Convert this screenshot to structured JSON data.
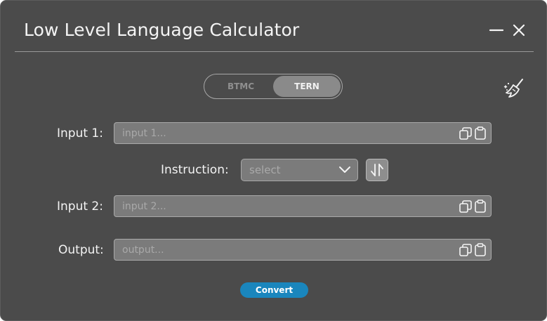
{
  "window": {
    "title": "Low Level Language Calculator"
  },
  "mode_toggle": {
    "options": [
      {
        "label": "BTMC",
        "selected": false
      },
      {
        "label": "TERN",
        "selected": true
      }
    ]
  },
  "form": {
    "input1": {
      "label": "Input 1:",
      "value": "",
      "placeholder": "input 1..."
    },
    "instruction": {
      "label": "Instruction:",
      "selected": "select"
    },
    "input2": {
      "label": "Input 2:",
      "value": "",
      "placeholder": "input 2..."
    },
    "output": {
      "label": "Output:",
      "value": "",
      "placeholder": "output..."
    }
  },
  "convert_button": {
    "label": "Convert"
  },
  "icons": {
    "minimize": "minimize-icon",
    "close": "close-icon",
    "clear": "broom-icon",
    "copy": "copy-icon",
    "paste": "clipboard-icon",
    "dropdown": "chevron-down-icon",
    "swap": "swap-arrows-icon"
  },
  "colors": {
    "window_background": "#4b4b4b",
    "field_background": "#7b7b7b",
    "accent": "#1a86bd",
    "text": "#f3f3f3",
    "placeholder": "#a9a9a9"
  }
}
